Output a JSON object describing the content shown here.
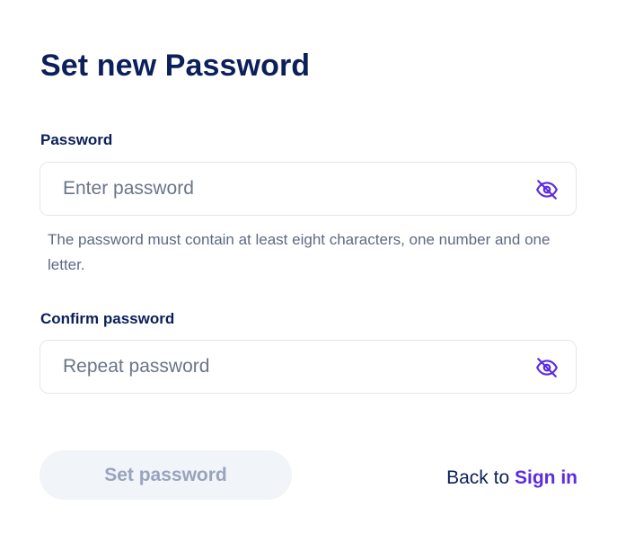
{
  "title": "Set new Password",
  "password": {
    "label": "Password",
    "placeholder": "Enter password",
    "value": "",
    "toggle_icon": "eye-off-icon",
    "hint": "The password must contain at least eight characters, one number and one letter."
  },
  "confirm": {
    "label": "Confirm password",
    "placeholder": "Repeat password",
    "value": "",
    "toggle_icon": "eye-off-icon"
  },
  "submit": {
    "label": "Set password",
    "disabled": true
  },
  "footer": {
    "back_prefix": "Back to",
    "sign_in_link": "Sign in"
  },
  "colors": {
    "heading": "#0b1f5a",
    "accent": "#5b2be0",
    "hint": "#5e6a80",
    "disabled_button_bg": "#f1f4f8",
    "disabled_button_text": "#98a4bd",
    "input_border": "#e3e6ec"
  }
}
